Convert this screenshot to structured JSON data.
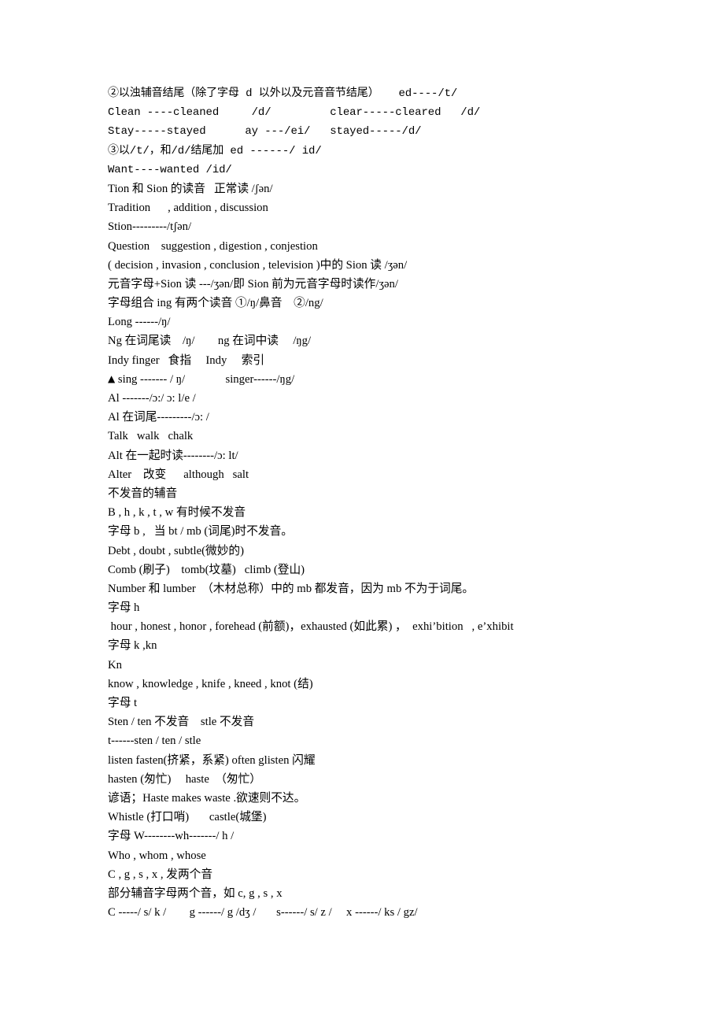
{
  "document": {
    "background_color": "#ffffff",
    "text_color": "#000000",
    "lines": [
      {
        "id": "l1",
        "style": "mono",
        "text": "②以浊辅音结尾（除了字母 d 以外以及元音音节结尾）   ed----/t/"
      },
      {
        "id": "l2",
        "style": "mono",
        "text": "Clean ----cleaned     /d/         clear-----cleared   /d/"
      },
      {
        "id": "l3",
        "style": "mono",
        "text": "Stay-----stayed      ay ---/ei/   stayed-----/d/"
      },
      {
        "id": "l4",
        "style": "mono",
        "text": "③以/t/，和/d/结尾加 ed ------/ id/"
      },
      {
        "id": "l5",
        "style": "mono",
        "text": "Want----wanted /id/"
      },
      {
        "id": "l6",
        "style": "serif",
        "text": "Tion 和 Sion 的读音   正常读 /ʃən/"
      },
      {
        "id": "l7",
        "style": "serif",
        "text": "Tradition      , addition , discussion"
      },
      {
        "id": "l8",
        "style": "serif",
        "text": "Stion---------/tʃən/"
      },
      {
        "id": "l9",
        "style": "serif",
        "text": "Question    suggestion , digestion , conjestion"
      },
      {
        "id": "l10",
        "style": "serif",
        "text": "( decision , invasion , conclusion , television )中的 Sion 读 /ʒən/"
      },
      {
        "id": "l11",
        "style": "serif",
        "text": "元音字母+Sion 读 ---/ʒən/即 Sion 前为元音字母时读作/ʒən/"
      },
      {
        "id": "l12",
        "style": "serif",
        "text": "字母组合 ing 有两个读音 ①/ŋ/鼻音    ②/ng/"
      },
      {
        "id": "l13",
        "style": "serif",
        "text": "Long ------/ŋ/"
      },
      {
        "id": "l14",
        "style": "serif",
        "text": "Ng 在词尾读    /ŋ/        ng 在词中读     /ŋg/"
      },
      {
        "id": "l15",
        "style": "serif",
        "text": "Indy finger   食指     Indy     索引"
      },
      {
        "id": "l16",
        "style": "serif",
        "triangle": true,
        "text": " sing ------- / ŋ/              singer------/ŋg/"
      },
      {
        "id": "l17",
        "style": "serif",
        "text": "Al -------/ɔ:/ ɔ: l/e /"
      },
      {
        "id": "l18",
        "style": "serif",
        "text": "Al 在词尾---------/ɔ: /"
      },
      {
        "id": "l19",
        "style": "serif",
        "text": "Talk   walk   chalk"
      },
      {
        "id": "l20",
        "style": "serif",
        "text": "Alt 在一起时读--------/ɔ: lt/"
      },
      {
        "id": "l21",
        "style": "serif",
        "text": "Alter    改变      although   salt"
      },
      {
        "id": "l22",
        "style": "serif",
        "text": "不发音的辅音"
      },
      {
        "id": "l23",
        "style": "serif",
        "text": "B , h , k , t , w 有时候不发音"
      },
      {
        "id": "l24",
        "style": "serif",
        "text": "字母 b ,   当 bt / mb (词尾)时不发音。"
      },
      {
        "id": "l25",
        "style": "serif",
        "text": "Debt , doubt , subtle(微妙的)"
      },
      {
        "id": "l26",
        "style": "serif",
        "text": "Comb (刷子)    tomb(坟墓)   climb (登山)"
      },
      {
        "id": "l27",
        "style": "serif",
        "text": "Number 和 lumber  （木材总称）中的 mb 都发音，因为 mb 不为于词尾。"
      },
      {
        "id": "l28",
        "style": "serif",
        "text": "字母 h"
      },
      {
        "id": "l29",
        "style": "serif",
        "text": " hour , honest , honor , forehead (前额)，exhausted (如此累) ，  exhi’bition   , e’xhibit"
      },
      {
        "id": "l30",
        "style": "serif",
        "text": "字母 k ,kn"
      },
      {
        "id": "l31",
        "style": "serif",
        "text": "Kn"
      },
      {
        "id": "l32",
        "style": "serif",
        "text": "know , knowledge , knife , kneed , knot (结)"
      },
      {
        "id": "l33",
        "style": "serif",
        "text": "字母 t"
      },
      {
        "id": "l34",
        "style": "serif",
        "text": "Sten / ten 不发音    stle 不发音"
      },
      {
        "id": "l35",
        "style": "serif",
        "text": "t------sten / ten / stle"
      },
      {
        "id": "l36",
        "style": "serif",
        "text": "listen fasten(挤紧，系紧) often glisten 闪耀"
      },
      {
        "id": "l37",
        "style": "serif",
        "text": "hasten (匆忙)     haste  （匆忙）"
      },
      {
        "id": "l38",
        "style": "serif",
        "text": "谚语；Haste makes waste .欲速则不达。"
      },
      {
        "id": "l39",
        "style": "serif",
        "text": "Whistle (打口哨)       castle(城堡)"
      },
      {
        "id": "l40",
        "style": "serif",
        "text": "字母 W--------wh-------/ h /"
      },
      {
        "id": "l41",
        "style": "serif",
        "text": "Who , whom , whose"
      },
      {
        "id": "l42",
        "style": "serif",
        "text": "C , g , s , x , 发两个音"
      },
      {
        "id": "l43",
        "style": "serif",
        "text": "部分辅音字母两个音，如 c, g , s , x"
      },
      {
        "id": "l44",
        "style": "serif",
        "text": "C -----/ s/ k /        g ------/ g /dʒ /       s------/ s/ z /     x ------/ ks / gz/"
      }
    ]
  }
}
